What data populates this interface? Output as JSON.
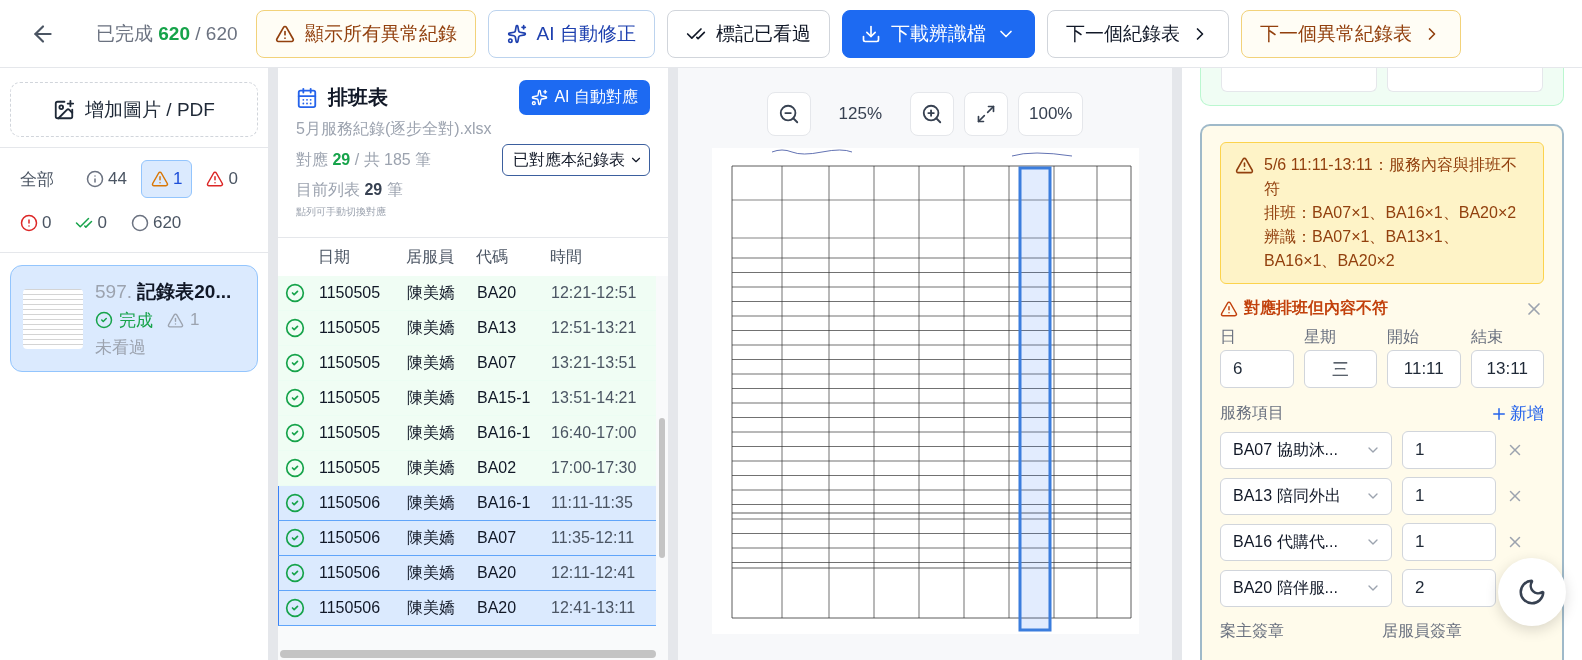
{
  "toolbar": {
    "progress": {
      "label": "已完成",
      "done": "620",
      "total": "/ 620"
    },
    "buttons": [
      {
        "label": "顯示所有異常紀錄",
        "kind": "warning"
      },
      {
        "label": "AI 自動修正",
        "kind": "ai"
      },
      {
        "label": "標記已看過",
        "kind": "check"
      },
      {
        "label": "下載辨識檔",
        "kind": "download"
      },
      {
        "label": "下一個紀錄表",
        "kind": "next"
      },
      {
        "label": "下一個異常紀錄表",
        "kind": "next-warning"
      }
    ]
  },
  "sidebar": {
    "add_button": "增加圖片 / PDF",
    "filters": [
      {
        "kind": "all",
        "label": "全部",
        "selected": false
      },
      {
        "kind": "info",
        "label": "44",
        "selected": false
      },
      {
        "kind": "warning",
        "label": "1",
        "selected": true
      },
      {
        "kind": "error",
        "label": "0",
        "selected": false
      },
      {
        "kind": "alert",
        "label": "0",
        "selected": false
      },
      {
        "kind": "seen",
        "label": "0",
        "selected": false
      },
      {
        "kind": "unseen",
        "label": "620",
        "selected": false
      }
    ],
    "records": [
      {
        "number": "597.",
        "title": "記錄表20...",
        "status": "完成",
        "warnings": "1",
        "seen": "未看過",
        "selected": true
      }
    ]
  },
  "schedule": {
    "title": "排班表",
    "ai_button": "AI 自動對應",
    "file": "5月服務紀錄(逐步全對).xlsx",
    "matched": {
      "label": "對應",
      "count": "29",
      "rest": "/ 共 185 筆"
    },
    "current": {
      "label": "目前列表",
      "count": "29",
      "unit": "筆"
    },
    "hint": "點列可手動切換對應",
    "filter_select": "已對應本紀錄表",
    "columns": [
      "日期",
      "居服員",
      "代碼",
      "時間"
    ],
    "rows": [
      {
        "date": "1150505",
        "worker": "陳美嬌",
        "code": "BA20",
        "time": "12:21-12:51",
        "selected": false
      },
      {
        "date": "1150505",
        "worker": "陳美嬌",
        "code": "BA13",
        "time": "12:51-13:21",
        "selected": false
      },
      {
        "date": "1150505",
        "worker": "陳美嬌",
        "code": "BA07",
        "time": "13:21-13:51",
        "selected": false
      },
      {
        "date": "1150505",
        "worker": "陳美嬌",
        "code": "BA15-1",
        "time": "13:51-14:21",
        "selected": false
      },
      {
        "date": "1150505",
        "worker": "陳美嬌",
        "code": "BA16-1",
        "time": "16:40-17:00",
        "selected": false
      },
      {
        "date": "1150505",
        "worker": "陳美嬌",
        "code": "BA02",
        "time": "17:00-17:30",
        "selected": false
      },
      {
        "date": "1150506",
        "worker": "陳美嬌",
        "code": "BA16-1",
        "time": "11:11-11:35",
        "selected": true
      },
      {
        "date": "1150506",
        "worker": "陳美嬌",
        "code": "BA07",
        "time": "11:35-12:11",
        "selected": true
      },
      {
        "date": "1150506",
        "worker": "陳美嬌",
        "code": "BA20",
        "time": "12:11-12:41",
        "selected": true
      },
      {
        "date": "1150506",
        "worker": "陳美嬌",
        "code": "BA20",
        "time": "12:41-13:11",
        "selected": true
      }
    ]
  },
  "viewer": {
    "zoom": "125%",
    "reset": "100%"
  },
  "detail": {
    "alert": {
      "title": "5/6 11:11-13:11：服務內容與排班不符",
      "lines": [
        "排班：BA07×1、BA16×1、BA20×2",
        "辨識：BA07×1、BA13×1、BA16×1、BA20×2"
      ]
    },
    "status": "對應排班但內容不符",
    "fields": [
      {
        "label": "日",
        "value": "6"
      },
      {
        "label": "星期",
        "value": "三"
      },
      {
        "label": "開始",
        "value": "11:11"
      },
      {
        "label": "結束",
        "value": "13:11"
      }
    ],
    "services_label": "服務項目",
    "add_label": "新增",
    "services": [
      {
        "name": "BA07 協助沐...",
        "qty": "1"
      },
      {
        "name": "BA13 陪同外出",
        "qty": "1"
      },
      {
        "name": "BA16 代購代...",
        "qty": "1"
      },
      {
        "name": "BA20 陪伴服...",
        "qty": "2"
      }
    ],
    "signatures": [
      "案主簽章",
      "居服員簽章"
    ]
  }
}
